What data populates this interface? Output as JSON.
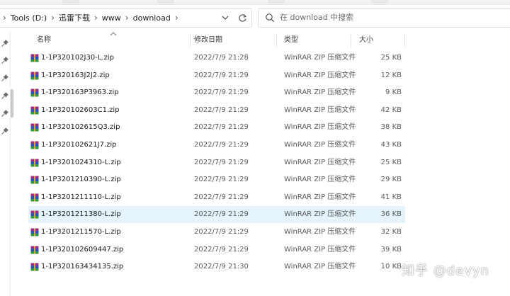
{
  "address": {
    "crumbs": [
      "Tools (D:)",
      "迅雷下载",
      "www",
      "download"
    ]
  },
  "search": {
    "placeholder": "在 download 中搜索"
  },
  "columns": {
    "name": "名称",
    "date": "修改日期",
    "type": "类型",
    "size": "大小"
  },
  "files": [
    {
      "name": "1-1P320102J30-L.zip",
      "date": "2022/7/9 21:28",
      "type": "WinRAR ZIP 压缩文件",
      "size": "25 KB"
    },
    {
      "name": "1-1P320163J2J2.zip",
      "date": "2022/7/9 21:29",
      "type": "WinRAR ZIP 压缩文件",
      "size": "12 KB"
    },
    {
      "name": "1-1P320163P3963.zip",
      "date": "2022/7/9 21:29",
      "type": "WinRAR ZIP 压缩文件",
      "size": "9 KB"
    },
    {
      "name": "1-1P320102603C1.zip",
      "date": "2022/7/9 21:29",
      "type": "WinRAR ZIP 压缩文件",
      "size": "42 KB"
    },
    {
      "name": "1-1P320102615Q3.zip",
      "date": "2022/7/9 21:29",
      "type": "WinRAR ZIP 压缩文件",
      "size": "38 KB"
    },
    {
      "name": "1-1P320102621J7.zip",
      "date": "2022/7/9 21:29",
      "type": "WinRAR ZIP 压缩文件",
      "size": "43 KB"
    },
    {
      "name": "1-1P3201024310-L.zip",
      "date": "2022/7/9 21:29",
      "type": "WinRAR ZIP 压缩文件",
      "size": "25 KB"
    },
    {
      "name": "1-1P3201210390-L.zip",
      "date": "2022/7/9 21:29",
      "type": "WinRAR ZIP 压缩文件",
      "size": "29 KB"
    },
    {
      "name": "1-1P3201211110-L.zip",
      "date": "2022/7/9 21:29",
      "type": "WinRAR ZIP 压缩文件",
      "size": "41 KB"
    },
    {
      "name": "1-1P3201211380-L.zip",
      "date": "2022/7/9 21:29",
      "type": "WinRAR ZIP 压缩文件",
      "size": "36 KB",
      "selected": true
    },
    {
      "name": "1-1P3201211570-L.zip",
      "date": "2022/7/9 21:29",
      "type": "WinRAR ZIP 压缩文件",
      "size": "32 KB"
    },
    {
      "name": "1-1P320102609447.zip",
      "date": "2022/7/9 21:29",
      "type": "WinRAR ZIP 压缩文件",
      "size": "39 KB"
    },
    {
      "name": "1-1P320163434135.zip",
      "date": "2022/7/9 21:30",
      "type": "WinRAR ZIP 压缩文件",
      "size": "10 KB"
    }
  ],
  "watermark": "知乎 @devyn",
  "icons": {
    "pin": "pin-icon",
    "file": "winrar-zip-file-icon",
    "search": "search-icon",
    "refresh": "refresh-icon",
    "dropdown": "chevron-down-icon"
  },
  "colors": {
    "selected_row": "#e5f3fb"
  }
}
